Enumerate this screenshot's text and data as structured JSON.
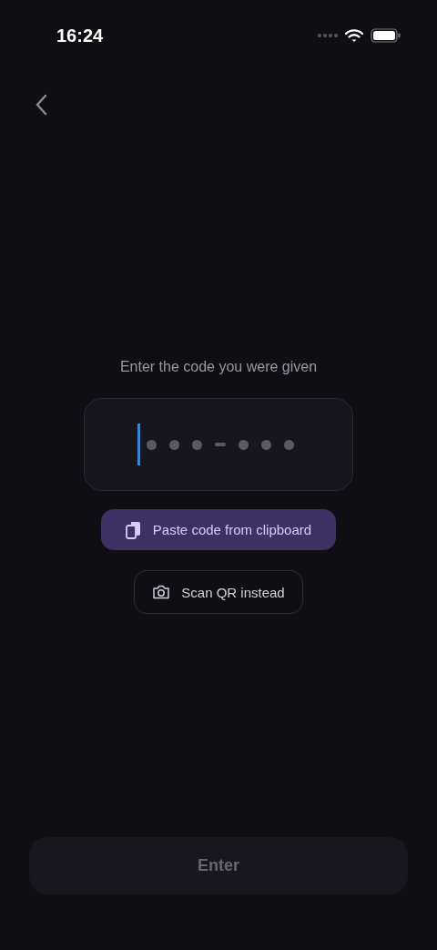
{
  "status_bar": {
    "time": "16:24"
  },
  "prompt": "Enter the code you were given",
  "code_field": {
    "focused": true,
    "groups": [
      [
        {
          "filled": false
        },
        {
          "filled": false
        },
        {
          "filled": false
        }
      ],
      [
        {
          "filled": false
        },
        {
          "filled": false
        },
        {
          "filled": false
        }
      ]
    ]
  },
  "actions": [
    {
      "kind": "paste",
      "label": "Paste code from clipboard"
    },
    {
      "kind": "scan",
      "label": "Scan QR instead"
    }
  ],
  "submit": {
    "label": "Enter",
    "disabled": true
  }
}
